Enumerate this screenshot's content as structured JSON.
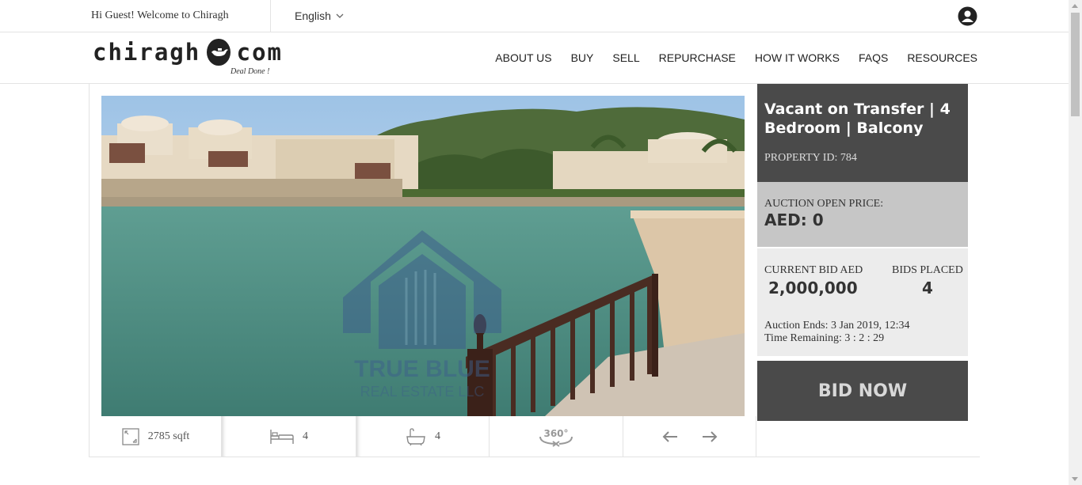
{
  "topbar": {
    "welcome": "Hi Guest! Welcome to Chiragh",
    "language": "English"
  },
  "logo": {
    "left": "chiragh",
    "right": "com",
    "tagline": "Deal Done !"
  },
  "nav": [
    "ABOUT US",
    "BUY",
    "SELL",
    "REPURCHASE",
    "HOW IT WORKS",
    "FAQS",
    "RESOURCES"
  ],
  "photo": {
    "watermark_line1": "TRUE BLUE",
    "watermark_line2": "REAL ESTATE LLC"
  },
  "property": {
    "title": "Vacant on Transfer | 4 Bedroom | Balcony",
    "id_label": "PROPERTY ID: 784",
    "open_price_label": "AUCTION OPEN PRICE:",
    "open_price_value": "AED: 0",
    "current_bid_label": "CURRENT BID AED",
    "current_bid_value": "2,000,000",
    "bids_placed_label": "BIDS PLACED",
    "bids_placed_value": "4",
    "auction_ends": "Auction Ends: 3 Jan 2019, 12:34",
    "time_remaining": "Time Remaining: 3 : 2 : 29",
    "bid_button": "BID NOW"
  },
  "stats": {
    "area": "2785 sqft",
    "bedrooms": "4",
    "bathrooms": "4",
    "view360": "360°"
  },
  "colors": {
    "panel_dark": "#4a4a4a",
    "panel_mid": "#c6c6c6",
    "panel_light": "#ececec"
  }
}
